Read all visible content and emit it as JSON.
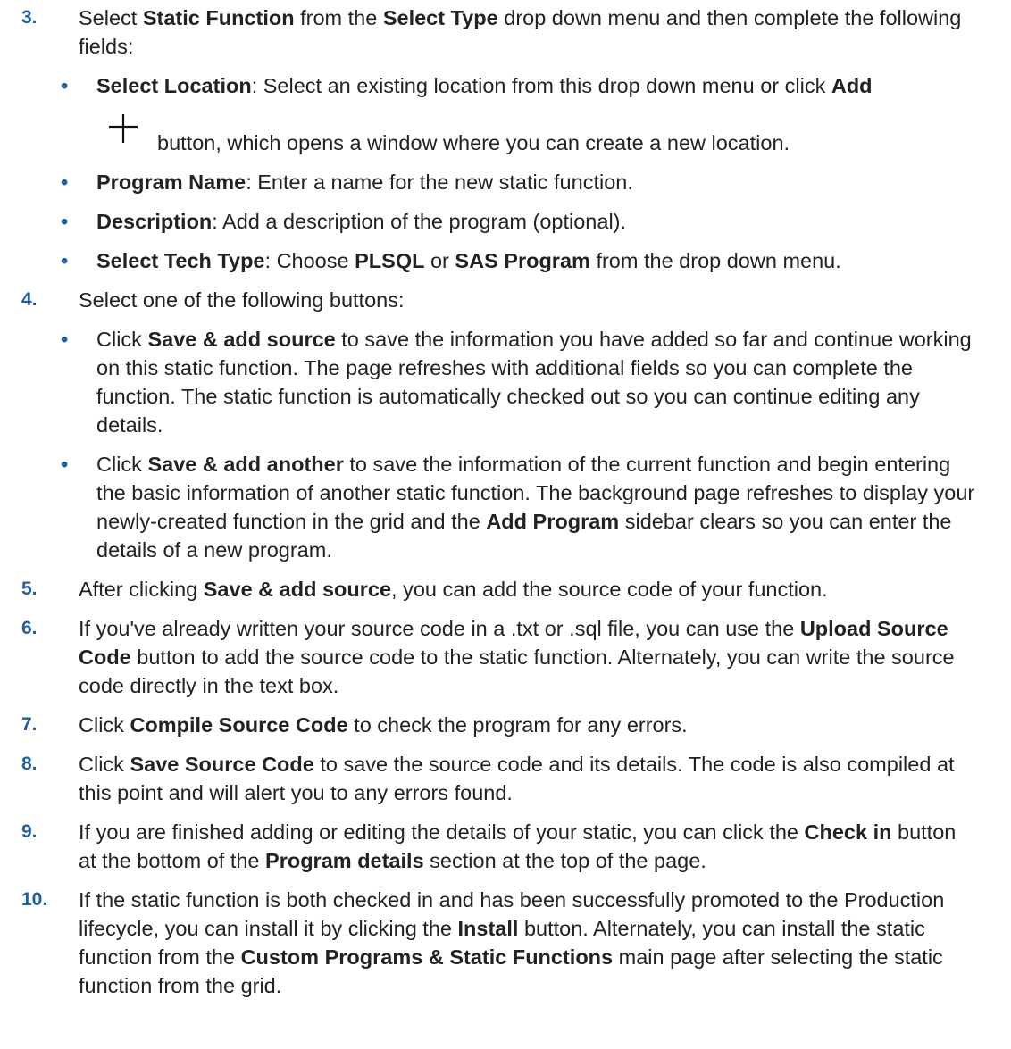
{
  "icons": {
    "add": "plus-icon"
  },
  "colors": {
    "step_number": "#1f5f9f",
    "bullet": "#1f5f9f",
    "text": "#222222"
  },
  "steps": {
    "s3": {
      "num": "3.",
      "t1": "Select ",
      "b1": "Static Function",
      "t2": " from the ",
      "b2": "Select Type",
      "t3": " drop down menu and then complete the following fields:",
      "items": {
        "loc": {
          "b1": "Select Location",
          "t1": ": Select an existing location from this drop down menu or click ",
          "b2": "Add",
          "t2": "button, which opens a window where you can create a new location."
        },
        "prog": {
          "b1": "Program Name",
          "t1": ": Enter a name for the new static function."
        },
        "desc": {
          "b1": "Description",
          "t1": ": Add a description of the program (optional)."
        },
        "tech": {
          "b1": "Select Tech Type",
          "t1": ": Choose ",
          "b2": "PLSQL",
          "t2": " or ",
          "b3": "SAS Program",
          "t3": " from the drop down menu."
        }
      }
    },
    "s4": {
      "num": "4.",
      "t1": "Select one of the following buttons:",
      "items": {
        "src": {
          "t1": "Click ",
          "b1": "Save & add source",
          "t2": " to save the information you have added so far and continue working on this static function. The page refreshes with additional fields so you can complete the function. The static function is automatically checked out so you can continue editing any details."
        },
        "another": {
          "t1": "Click ",
          "b1": "Save & add another",
          "t2": " to save the information of the current function and begin entering the basic information of another static function. The background page refreshes to display your newly-created function in the grid and the ",
          "b2": "Add Program",
          "t3": " sidebar clears so you can enter the details of a new program."
        }
      }
    },
    "s5": {
      "num": "5.",
      "t1": "After clicking ",
      "b1": "Save & add source",
      "t2": ", you can add the source code of your function."
    },
    "s6": {
      "num": "6.",
      "t1": "If you've already written your source code in a .txt or .sql file, you can use the ",
      "b1": "Upload Source Code",
      "t2": " button to add the source code to the static function. Alternately, you can write the source code directly in the text box."
    },
    "s7": {
      "num": "7.",
      "t1": "Click ",
      "b1": "Compile Source Code",
      "t2": " to check the program for any errors."
    },
    "s8": {
      "num": "8.",
      "t1": "Click ",
      "b1": "Save Source Code",
      "t2": " to save the source code and its details. The code is also compiled at this point and will alert you to any errors found."
    },
    "s9": {
      "num": "9.",
      "t1": "If you are finished adding or editing the details of your static, you can click the ",
      "b1": "Check in",
      "t2": " button at the bottom of the ",
      "b2": "Program details",
      "t3": " section at the top of the page."
    },
    "s10": {
      "num": "10.",
      "t1": "If the static function is both checked in and has been successfully promoted to the Production lifecycle, you can install it by clicking the ",
      "b1": "Install",
      "t2": " button. Alternately, you can install the static function from the ",
      "b2": "Custom Programs & Static Functions",
      "t3": " main page after selecting the static function from the grid."
    }
  }
}
